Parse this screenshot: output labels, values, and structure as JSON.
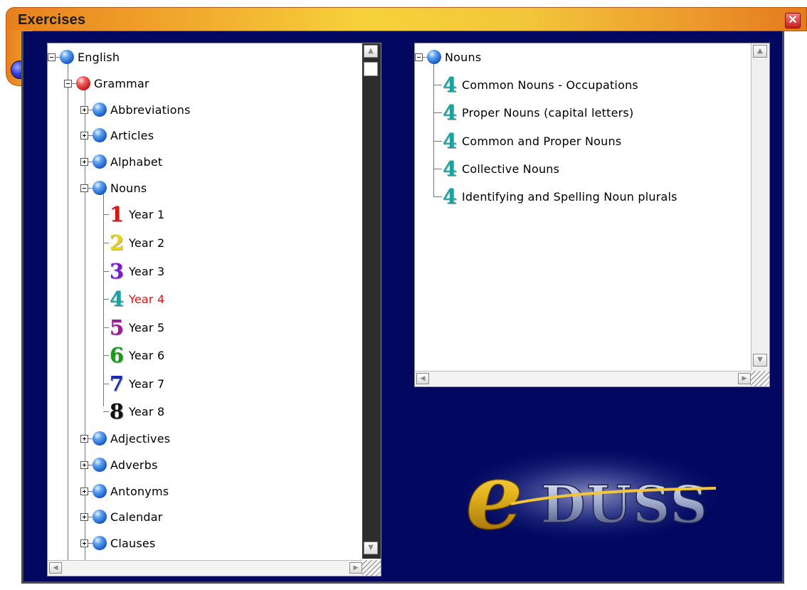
{
  "window": {
    "title": "Exercises",
    "close_symbol": "✕"
  },
  "left_tree": {
    "root": "English",
    "grammar": "Grammar",
    "topics_before": [
      "Abbreviations",
      "Articles",
      "Alphabet"
    ],
    "nouns": "Nouns",
    "years": [
      {
        "num": "1",
        "label": "Year 1",
        "color": "#d31a1a"
      },
      {
        "num": "2",
        "label": "Year 2",
        "color": "#e6d31a"
      },
      {
        "num": "3",
        "label": "Year 3",
        "color": "#7a1ad3"
      },
      {
        "num": "4",
        "label": "Year 4",
        "color": "#1aa3a3"
      },
      {
        "num": "5",
        "label": "Year 5",
        "color": "#9a1a9a"
      },
      {
        "num": "6",
        "label": "Year 6",
        "color": "#1a9a1a"
      },
      {
        "num": "7",
        "label": "Year 7",
        "color": "#1a2ab5"
      },
      {
        "num": "8",
        "label": "Year 8",
        "color": "#111111"
      }
    ],
    "topics_after": [
      "Adjectives",
      "Adverbs",
      "Antonyms",
      "Calendar",
      "Clauses"
    ]
  },
  "right_tree": {
    "root": "Nouns",
    "year_num": "4",
    "year_color": "#1aa3a3",
    "items": [
      "Common Nouns - Occupations",
      "Proper Nouns (capital letters)",
      "Common and Proper Nouns",
      "Collective Nouns",
      "Identifying and Spelling Noun plurals"
    ]
  },
  "logo": {
    "letter": "e",
    "rest": "DUSS"
  },
  "colors": {
    "accent": "#f0a82c",
    "background": "#020860",
    "active": "#e01010"
  }
}
